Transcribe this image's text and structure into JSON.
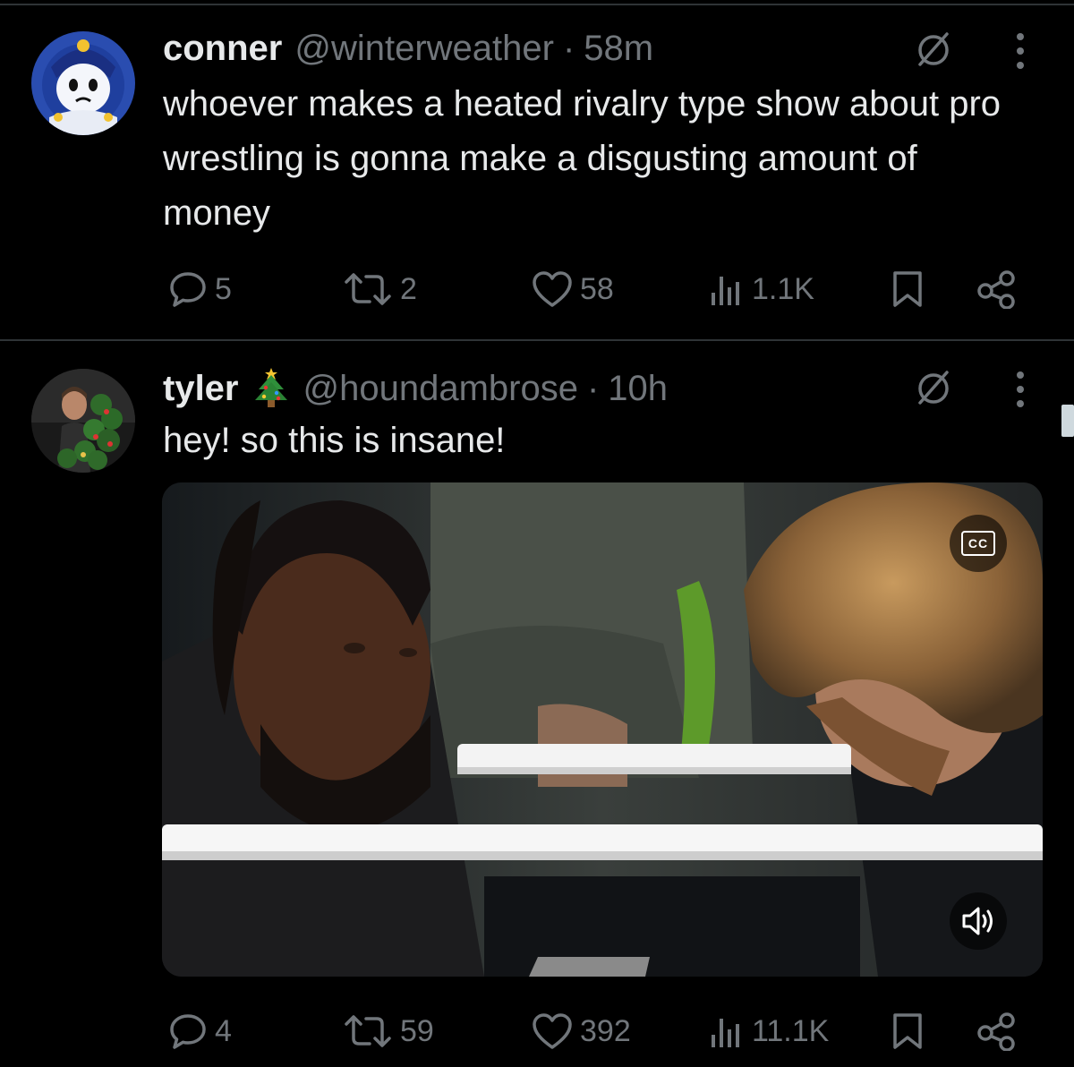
{
  "tweets": [
    {
      "display_name": "conner",
      "handle": "@winterweather",
      "separator": "·",
      "time": "58m",
      "text": "whoever makes a heated rivalry type show about pro wrestling is gonna make a disgusting amount of money",
      "replies": "5",
      "reposts": "2",
      "likes": "58",
      "views": "1.1K"
    },
    {
      "display_name": "tyler",
      "handle": "@houndambrose",
      "separator": "·",
      "time": "10h",
      "text": "hey! so this is insane!",
      "replies": "4",
      "reposts": "59",
      "likes": "392",
      "views": "11.1K",
      "media": {
        "cc_label": "CC"
      }
    }
  ],
  "icons": {
    "reply": "speech-bubble-icon",
    "repost": "repost-arrows-icon",
    "like": "heart-icon",
    "views": "bar-chart-icon",
    "bookmark": "bookmark-icon",
    "share": "share-nodes-icon",
    "grok": "slashed-circle-icon",
    "more": "vertical-dots-icon",
    "volume": "speaker-icon",
    "emoji": "christmas-tree-emoji"
  },
  "colors": {
    "background": "#000000",
    "text": "#e7e9ea",
    "secondary": "#71767b",
    "divider": "#2f3336"
  }
}
